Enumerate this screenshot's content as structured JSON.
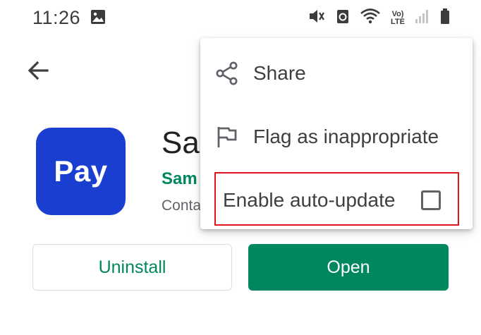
{
  "status_bar": {
    "time": "11:26",
    "lte_label": "LTE",
    "volte_label": "Vo)"
  },
  "app": {
    "icon_label": "Pay",
    "title": "Sam",
    "developer": "Sam",
    "meta": "Conta",
    "icon_color": "#1a3fd0",
    "accent_color": "#01875f"
  },
  "actions": {
    "uninstall_label": "Uninstall",
    "open_label": "Open"
  },
  "menu": {
    "share_label": "Share",
    "flag_label": "Flag as inappropriate",
    "auto_update_label": "Enable auto-update",
    "auto_update_checked": false
  },
  "icons": {
    "back": "arrow-left-icon",
    "share": "share-icon",
    "flag": "flag-icon",
    "gallery": "image-icon"
  }
}
